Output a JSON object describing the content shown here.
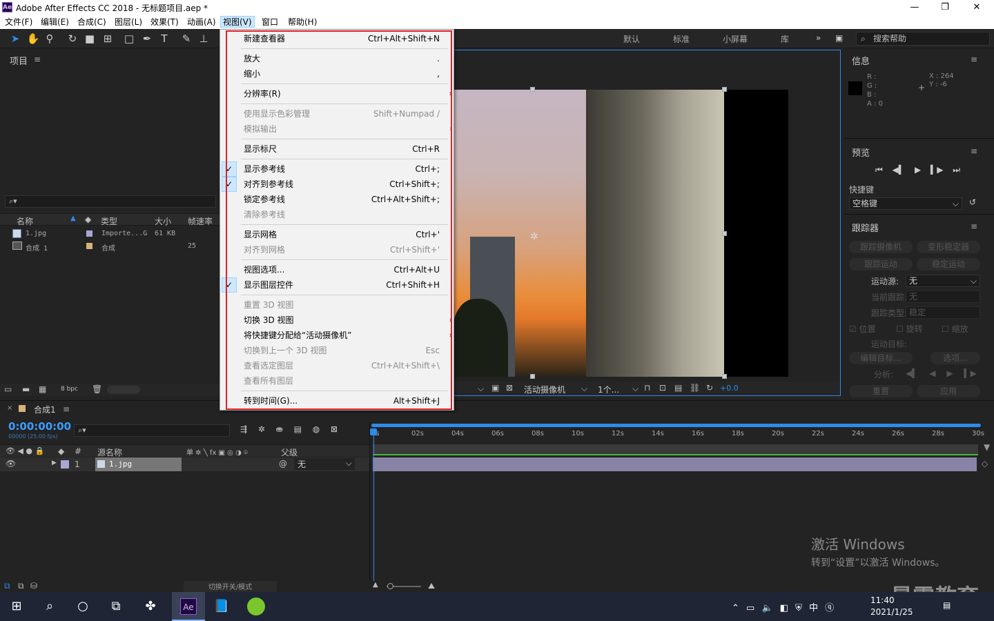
{
  "app": {
    "logo": "Ae",
    "title": "Adobe After Effects CC 2018 - 无标题项目.aep *",
    "win_min": "—",
    "win_max": "❐",
    "win_close": "✕"
  },
  "menubar": [
    "文件(F)",
    "编辑(E)",
    "合成(C)",
    "图层(L)",
    "效果(T)",
    "动画(A)",
    "视图(V)",
    "窗口",
    "帮助(H)"
  ],
  "workspaces": [
    "默认",
    "标准",
    "小屏幕",
    "库"
  ],
  "search_help": "搜索帮助",
  "project": {
    "title": "项目",
    "columns": [
      "名称",
      "类型",
      "大小",
      "帧速率"
    ],
    "rows": [
      {
        "name": "1.jpg",
        "type": "Importe...G",
        "size": "61 KB",
        "fps": ""
      },
      {
        "name": "合成 1",
        "type": "合成",
        "size": "",
        "fps": "25"
      }
    ],
    "bpc": "8 bpc"
  },
  "view_menu": {
    "items": [
      {
        "label": "新建查看器",
        "shortcut": "Ctrl+Alt+Shift+N",
        "disabled": false,
        "checked": false,
        "sub": false
      },
      {
        "sep": true
      },
      {
        "label": "放大",
        "shortcut": ".",
        "disabled": false
      },
      {
        "label": "缩小",
        "shortcut": ",",
        "disabled": false
      },
      {
        "sep": true
      },
      {
        "label": "分辨率(R)",
        "shortcut": "",
        "sub": true
      },
      {
        "sep": true
      },
      {
        "label": "使用显示色彩管理",
        "shortcut": "Shift+Numpad /",
        "disabled": true
      },
      {
        "label": "模拟输出",
        "shortcut": "",
        "disabled": true,
        "sub": true
      },
      {
        "sep": true
      },
      {
        "label": "显示标尺",
        "shortcut": "Ctrl+R"
      },
      {
        "sep": true
      },
      {
        "label": "显示参考线",
        "shortcut": "Ctrl+;",
        "checked": true
      },
      {
        "label": "对齐到参考线",
        "shortcut": "Ctrl+Shift+;",
        "checked": true
      },
      {
        "label": "锁定参考线",
        "shortcut": "Ctrl+Alt+Shift+;"
      },
      {
        "label": "清除参考线",
        "shortcut": "",
        "disabled": true
      },
      {
        "sep": true
      },
      {
        "label": "显示网格",
        "shortcut": "Ctrl+'"
      },
      {
        "label": "对齐到网格",
        "shortcut": "Ctrl+Shift+'",
        "disabled": true
      },
      {
        "sep": true
      },
      {
        "label": "视图选项...",
        "shortcut": "Ctrl+Alt+U"
      },
      {
        "label": "显示图层控件",
        "shortcut": "Ctrl+Shift+H",
        "checked": true
      },
      {
        "sep": true
      },
      {
        "label": "重置 3D 视图",
        "shortcut": "",
        "disabled": true
      },
      {
        "label": "切换 3D 视图",
        "shortcut": "",
        "sub": true
      },
      {
        "label": "将快捷键分配给“活动摄像机”",
        "shortcut": "",
        "sub": true
      },
      {
        "label": "切换到上一个 3D 视图",
        "shortcut": "Esc",
        "disabled": true
      },
      {
        "label": "查看选定图层",
        "shortcut": "Ctrl+Alt+Shift+\\",
        "disabled": true
      },
      {
        "label": "查看所有图层",
        "shortcut": "",
        "disabled": true
      },
      {
        "sep": true
      },
      {
        "label": "转到时间(G)...",
        "shortcut": "Alt+Shift+J"
      }
    ]
  },
  "viewer": {
    "camera": "活动摄像机",
    "views": "1个...",
    "exposure": "+0.0"
  },
  "info": {
    "title": "信息",
    "r": "R :",
    "g": "G :",
    "b": "B :",
    "a": "A : 0",
    "x": "X : 264",
    "y": "Y : -6"
  },
  "preview": {
    "title": "预览",
    "shortcut_label": "快捷键",
    "shortcut_value": "空格键"
  },
  "tracker": {
    "title": "跟踪器",
    "btn1": "跟踪摄像机",
    "btn2": "变形稳定器",
    "btn3": "跟踪运动",
    "btn4": "稳定运动",
    "motion_source_label": "运动源:",
    "motion_source": "无",
    "current_track_label": "当前跟踪:",
    "current_track": "无",
    "track_type_label": "跟踪类型:",
    "track_type": "稳定",
    "pos": "位置",
    "rot": "旋转",
    "scale": "缩放",
    "target_label": "运动目标:",
    "edit_target": "编辑目标...",
    "options": "选项...",
    "analyze": "分析:",
    "reset": "重置",
    "apply": "应用"
  },
  "timeline": {
    "comp": "合成1",
    "timecode": "0:00:00:00",
    "fps_line": "00000 (25.00 fps)",
    "col_source": "源名称",
    "col_parent": "父级",
    "layer_num": "1",
    "layer_name": "1.jpg",
    "parent_value": "无",
    "ticks": [
      "0s",
      "02s",
      "04s",
      "06s",
      "08s",
      "10s",
      "12s",
      "14s",
      "16s",
      "18s",
      "20s",
      "22s",
      "24s",
      "26s",
      "28s",
      "30s"
    ],
    "toggle_mode": "切换开关/模式"
  },
  "watermark": {
    "line1": "激活 Windows",
    "line2": "转到“设置”以激活 Windows。"
  },
  "brand_watermark": "最需教育",
  "taskbar": {
    "time": "11:40",
    "date": "2021/1/25",
    "lang": "中"
  }
}
